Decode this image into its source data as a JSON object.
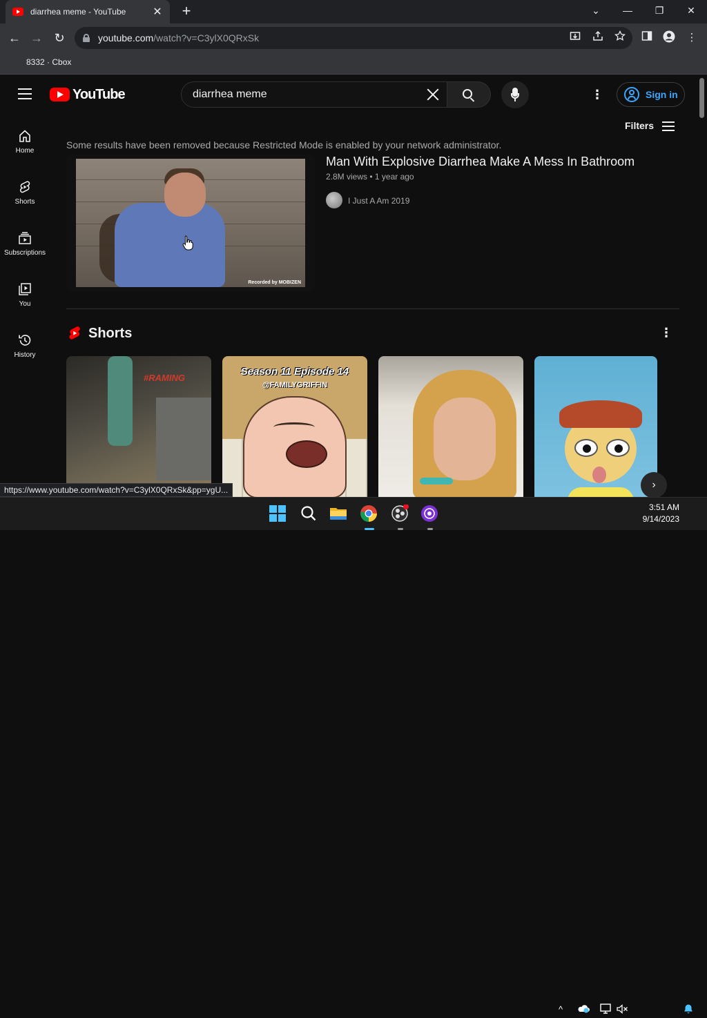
{
  "browser": {
    "tab_title": "diarrhea meme - YouTube",
    "tab_close": "✕",
    "new_tab": "+",
    "window_controls": {
      "dropdown": "⌄",
      "minimize": "—",
      "restore": "❐",
      "close": "✕"
    },
    "nav": {
      "back": "←",
      "forward": "→",
      "reload": "↻"
    },
    "url_host": "youtube.com",
    "url_path": "/watch?v=C3ylX0QRxSk",
    "bookmark": "8332 · Cbox",
    "status_url": "https://www.youtube.com/watch?v=C3ylX0QRxSk&pp=ygU..."
  },
  "youtube": {
    "logo_text": "YouTube",
    "search_value": "diarrhea meme",
    "kebab": "⋮",
    "sign_in": "Sign in",
    "sidebar": [
      {
        "label": "Home",
        "icon": "home-icon"
      },
      {
        "label": "Shorts",
        "icon": "shorts-icon"
      },
      {
        "label": "Subscriptions",
        "icon": "subscriptions-icon"
      },
      {
        "label": "You",
        "icon": "you-icon"
      },
      {
        "label": "History",
        "icon": "history-icon"
      }
    ],
    "filters": "Filters",
    "restricted_notice": "Some results have been removed because Restricted Mode is enabled by your network administrator.",
    "result": {
      "title": "Man With Explosive Diarrhea Make A Mess In Bathroom",
      "meta": "2.8M views • 1 year ago",
      "channel": "I Just A Am 2019",
      "thumb_watermark": "Recorded by MOBIZEN"
    },
    "shorts": {
      "title": "Shorts",
      "kebab": "⋮",
      "items": [
        {
          "overlay": "#RAMING"
        },
        {
          "overlay": "Season 11 Episode 14",
          "sub": "@FAMILYGRIFFIN"
        },
        {
          "overlay": ""
        },
        {
          "overlay": ""
        }
      ],
      "next": "›"
    }
  },
  "taskbar": {
    "time": "3:51 AM",
    "date": "9/14/2023",
    "tray_chevron": "^"
  },
  "colors": {
    "youtube_red": "#ff0000",
    "link_blue": "#3ea6ff",
    "bg": "#0f0f0f"
  }
}
